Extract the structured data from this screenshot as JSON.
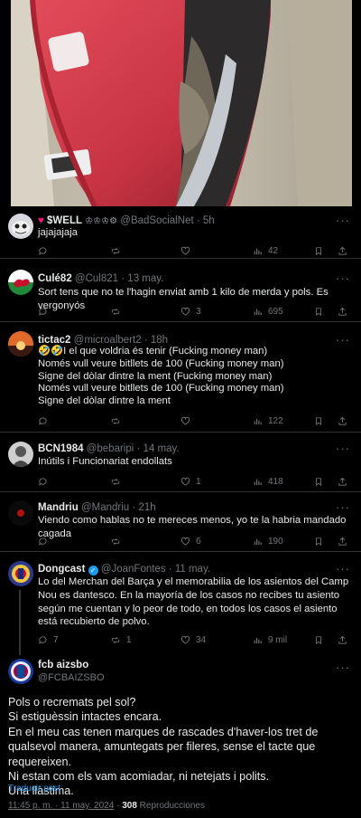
{
  "replies": [
    {
      "name": "$WELL",
      "handle": "@BadSocialNet",
      "time": "5h",
      "text": "jajajajaja",
      "stats": {
        "replies": "",
        "reposts": "",
        "likes": "",
        "views": "42"
      }
    },
    {
      "name": "Culé82",
      "handle": "@Cul821",
      "time": "13 may.",
      "text": "Sort tens que no te l'hagin enviat amb 1 kilo de merda y pols. Es vergonyós",
      "stats": {
        "replies": "",
        "reposts": "",
        "likes": "3",
        "views": "695"
      }
    },
    {
      "name": "tictac2",
      "handle": "@microalbert2",
      "time": "18h",
      "emoji_prefix": "🤣🤣",
      "lines": [
        "I el que voldria és tenir (Fucking money man)",
        "Només vull veure bitllets de 100 (Fucking money man)",
        "Signe del dòlar dintre la ment (Fucking money man)",
        "Només vull veure bitllets de 100 (Fucking money man)",
        "Signe del dòlar dintre la ment"
      ],
      "stats": {
        "replies": "",
        "reposts": "",
        "likes": "",
        "views": "122"
      }
    },
    {
      "name": "BCN1984",
      "handle": "@bebaripi",
      "time": "14 may.",
      "text": "Inútils i Funcionariat endollats",
      "stats": {
        "replies": "",
        "reposts": "",
        "likes": "1",
        "views": "418"
      }
    },
    {
      "name": "Mandriu",
      "handle": "@Mandriu",
      "time": "21h",
      "text": "Viendo como hablas no te mereces menos, yo te la habria mandado cagada",
      "stats": {
        "replies": "",
        "reposts": "",
        "likes": "6",
        "views": "190"
      }
    },
    {
      "name": "Dongcast",
      "handle": "@JoanFontes",
      "time": "11 may.",
      "text": "Lo del Merchan del Barça y el memorabilia de los asientos del Camp Nou es dantesco. En la mayoría de los casos no recibes tu asiento según me cuentan y lo peor de todo, en todos los casos el asiento está recubierto de polvo.",
      "stats": {
        "replies": "7",
        "reposts": "1",
        "likes": "34",
        "views": "9 mil"
      }
    }
  ],
  "main_post": {
    "name": "fcb aizsbo",
    "handle": "@FCBAIZSBO",
    "lines": [
      "Pols o recremats pel sol?",
      "Si estiguèssin intactes encara.",
      "En el meu cas tenen marques de  rascades d'haver-los tret de qualsevol manera, amuntegats per fileres, sense el tacte que requereixen.",
      "Ni estan com els vam acomiadar, ni netejats i polits.",
      "Una llàstima."
    ],
    "translate": "Traducir post",
    "timestamp": "11:45 p. m. · 11 may. 2024",
    "views_count": "308",
    "views_label": "Reproducciones"
  },
  "dot_separator": "·",
  "more_label": "···",
  "colors": {
    "accent": "#1d9bf0",
    "muted": "#71767b",
    "border": "#2f3336",
    "verified": "#1d9bf0",
    "gold": "#f4c542"
  }
}
